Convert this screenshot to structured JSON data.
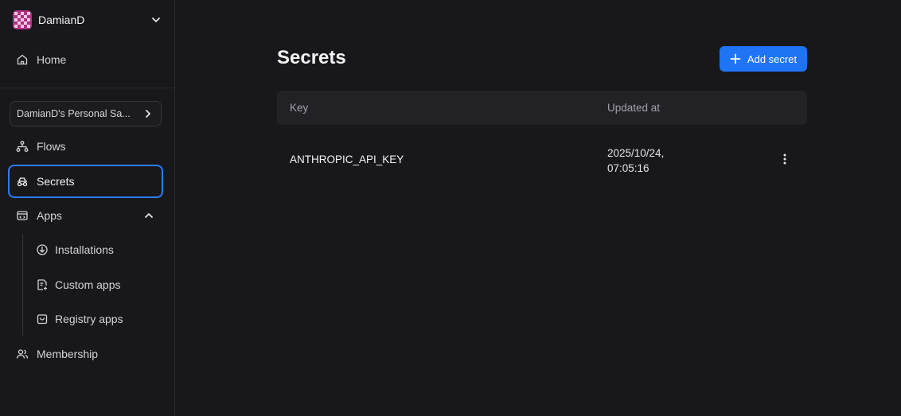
{
  "sidebar": {
    "user": {
      "name": "DamianD"
    },
    "home_label": "Home",
    "workspace_label": "DamianD's Personal Sa...",
    "items": [
      {
        "label": "Flows"
      },
      {
        "label": "Secrets"
      },
      {
        "label": "Apps"
      }
    ],
    "apps_sub": [
      {
        "label": "Installations"
      },
      {
        "label": "Custom apps"
      },
      {
        "label": "Registry apps"
      }
    ],
    "membership_label": "Membership"
  },
  "main": {
    "title": "Secrets",
    "add_button_label": "Add secret",
    "table": {
      "columns": [
        "Key",
        "Updated at"
      ],
      "rows": [
        {
          "key": "ANTHROPIC_API_KEY",
          "updated_date": "2025/10/24,",
          "updated_time": "07:05:16"
        }
      ]
    }
  },
  "colors": {
    "accent": "#1e74f5",
    "active_border": "#2f7bf5",
    "background": "#18181b"
  }
}
